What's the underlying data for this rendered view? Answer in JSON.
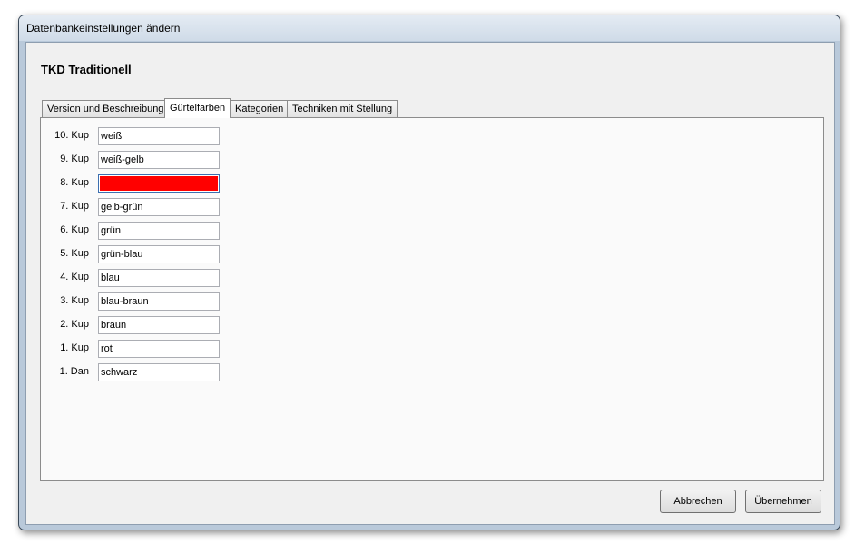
{
  "window": {
    "title": "Datenbankeinstellungen ändern"
  },
  "heading": "TKD Traditionell",
  "tabs": [
    {
      "label": "Version und Beschreibung",
      "active": false
    },
    {
      "label": "Gürtelfarben",
      "active": true
    },
    {
      "label": "Kategorien",
      "active": false
    },
    {
      "label": "Techniken mit Stellung",
      "active": false
    }
  ],
  "belts": [
    {
      "label": "10. Kup",
      "value": "weiß"
    },
    {
      "label": "9. Kup",
      "value": "weiß-gelb"
    },
    {
      "label": "8. Kup",
      "value": "",
      "fill_color": "#ff0000"
    },
    {
      "label": "7. Kup",
      "value": "gelb-grün"
    },
    {
      "label": "6. Kup",
      "value": "grün"
    },
    {
      "label": "5. Kup",
      "value": "grün-blau"
    },
    {
      "label": "4. Kup",
      "value": "blau"
    },
    {
      "label": "3. Kup",
      "value": "blau-braun"
    },
    {
      "label": "2. Kup",
      "value": "braun"
    },
    {
      "label": "1. Kup",
      "value": "rot"
    },
    {
      "label": "1. Dan",
      "value": "schwarz"
    }
  ],
  "buttons": {
    "cancel": "Abbrechen",
    "apply": "Übernehmen"
  }
}
